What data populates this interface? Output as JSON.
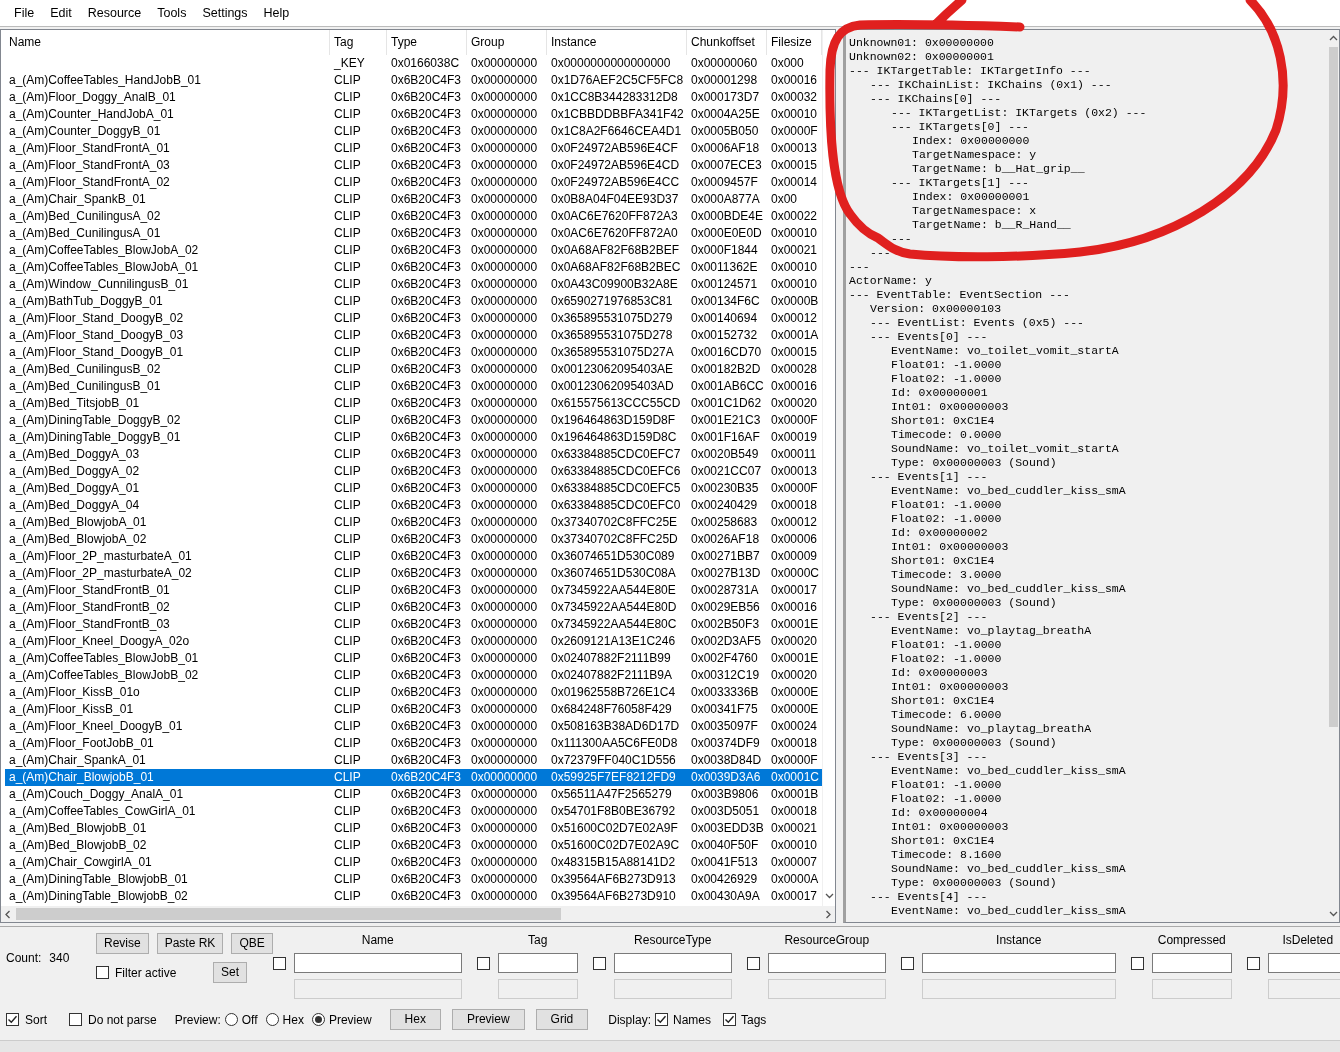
{
  "menu": [
    "File",
    "Edit",
    "Resource",
    "Tools",
    "Settings",
    "Help"
  ],
  "table": {
    "columns": [
      "Name",
      "Tag",
      "Type",
      "Group",
      "Instance",
      "Chunkoffset",
      "Filesize"
    ],
    "rows": [
      {
        "tag": "_KEY",
        "type": "0x0166038C",
        "group": "0x00000000",
        "instance": "0x0000000000000000",
        "chunkoffset": "0x00000060",
        "filesize": "0x000",
        "selected": false
      },
      {
        "name": "a_(Am)CoffeeTables_HandJobB_01",
        "tag": "CLIP",
        "type": "0x6B20C4F3",
        "group": "0x00000000",
        "instance": "0x1D76AEF2C5CF5FC8",
        "chunkoffset": "0x00001298",
        "filesize": "0x00016",
        "selected": false
      },
      {
        "name": "a_(Am)Floor_Doggy_AnalB_01",
        "tag": "CLIP",
        "type": "0x6B20C4F3",
        "group": "0x00000000",
        "instance": "0x1CC8B344283312D8",
        "chunkoffset": "0x000173D7",
        "filesize": "0x00032",
        "selected": false
      },
      {
        "name": "a_(Am)Counter_HandJobA_01",
        "tag": "CLIP",
        "type": "0x6B20C4F3",
        "group": "0x00000000",
        "instance": "0x1CBBDDBBFA341F42",
        "chunkoffset": "0x0004A25E",
        "filesize": "0x00010",
        "selected": false
      },
      {
        "name": "a_(Am)Counter_DoggyB_01",
        "tag": "CLIP",
        "type": "0x6B20C4F3",
        "group": "0x00000000",
        "instance": "0x1C8A2F6646CEA4D1",
        "chunkoffset": "0x0005B050",
        "filesize": "0x0000F",
        "selected": false
      },
      {
        "name": "a_(Am)Floor_StandFrontA_01",
        "tag": "CLIP",
        "type": "0x6B20C4F3",
        "group": "0x00000000",
        "instance": "0x0F24972AB596E4CF",
        "chunkoffset": "0x0006AF18",
        "filesize": "0x00013",
        "selected": false
      },
      {
        "name": "a_(Am)Floor_StandFrontA_03",
        "tag": "CLIP",
        "type": "0x6B20C4F3",
        "group": "0x00000000",
        "instance": "0x0F24972AB596E4CD",
        "chunkoffset": "0x0007ECE3",
        "filesize": "0x00015",
        "selected": false
      },
      {
        "name": "a_(Am)Floor_StandFrontA_02",
        "tag": "CLIP",
        "type": "0x6B20C4F3",
        "group": "0x00000000",
        "instance": "0x0F24972AB596E4CC",
        "chunkoffset": "0x0009457F",
        "filesize": "0x00014",
        "selected": false
      },
      {
        "name": "a_(Am)Chair_SpankB_01",
        "tag": "CLIP",
        "type": "0x6B20C4F3",
        "group": "0x00000000",
        "instance": "0x0B8A04F04EE93D37",
        "chunkoffset": "0x000A877A",
        "filesize": "0x00",
        "selected": false
      },
      {
        "name": "a_(Am)Bed_CunilingusA_02",
        "tag": "CLIP",
        "type": "0x6B20C4F3",
        "group": "0x00000000",
        "instance": "0x0AC6E7620FF872A3",
        "chunkoffset": "0x000BDE4E",
        "filesize": "0x00022",
        "selected": false
      },
      {
        "name": "a_(Am)Bed_CunilingusA_01",
        "tag": "CLIP",
        "type": "0x6B20C4F3",
        "group": "0x00000000",
        "instance": "0x0AC6E7620FF872A0",
        "chunkoffset": "0x000E0E0D",
        "filesize": "0x00010",
        "selected": false
      },
      {
        "name": "a_(Am)CoffeeTables_BlowJobA_02",
        "tag": "CLIP",
        "type": "0x6B20C4F3",
        "group": "0x00000000",
        "instance": "0x0A68AF82F68B2BEF",
        "chunkoffset": "0x000F1844",
        "filesize": "0x00021",
        "selected": false
      },
      {
        "name": "a_(Am)CoffeeTables_BlowJobA_01",
        "tag": "CLIP",
        "type": "0x6B20C4F3",
        "group": "0x00000000",
        "instance": "0x0A68AF82F68B2BEC",
        "chunkoffset": "0x0011362E",
        "filesize": "0x00010",
        "selected": false
      },
      {
        "name": "a_(Am)Window_CunnilingusB_01",
        "tag": "CLIP",
        "type": "0x6B20C4F3",
        "group": "0x00000000",
        "instance": "0x0A43C09900B32A8E",
        "chunkoffset": "0x00124571",
        "filesize": "0x00010",
        "selected": false
      },
      {
        "name": "a_(Am)BathTub_DoggyB_01",
        "tag": "CLIP",
        "type": "0x6B20C4F3",
        "group": "0x00000000",
        "instance": "0x6590271976853C81",
        "chunkoffset": "0x00134F6C",
        "filesize": "0x0000B",
        "selected": false
      },
      {
        "name": "a_(Am)Floor_Stand_DoogyB_02",
        "tag": "CLIP",
        "type": "0x6B20C4F3",
        "group": "0x00000000",
        "instance": "0x365895531075D279",
        "chunkoffset": "0x00140694",
        "filesize": "0x00012",
        "selected": false
      },
      {
        "name": "a_(Am)Floor_Stand_DoogyB_03",
        "tag": "CLIP",
        "type": "0x6B20C4F3",
        "group": "0x00000000",
        "instance": "0x365895531075D278",
        "chunkoffset": "0x00152732",
        "filesize": "0x0001A",
        "selected": false
      },
      {
        "name": "a_(Am)Floor_Stand_DoogyB_01",
        "tag": "CLIP",
        "type": "0x6B20C4F3",
        "group": "0x00000000",
        "instance": "0x365895531075D27A",
        "chunkoffset": "0x0016CD70",
        "filesize": "0x00015",
        "selected": false
      },
      {
        "name": "a_(Am)Bed_CunilingusB_02",
        "tag": "CLIP",
        "type": "0x6B20C4F3",
        "group": "0x00000000",
        "instance": "0x00123062095403AE",
        "chunkoffset": "0x00182B2D",
        "filesize": "0x00028",
        "selected": false
      },
      {
        "name": "a_(Am)Bed_CunilingusB_01",
        "tag": "CLIP",
        "type": "0x6B20C4F3",
        "group": "0x00000000",
        "instance": "0x00123062095403AD",
        "chunkoffset": "0x001AB6CC",
        "filesize": "0x00016",
        "selected": false
      },
      {
        "name": "a_(Am)Bed_TitsjobB_01",
        "tag": "CLIP",
        "type": "0x6B20C4F3",
        "group": "0x00000000",
        "instance": "0x615575613CCC55CD",
        "chunkoffset": "0x001C1D62",
        "filesize": "0x00020",
        "selected": false
      },
      {
        "name": "a_(Am)DiningTable_DoggyB_02",
        "tag": "CLIP",
        "type": "0x6B20C4F3",
        "group": "0x00000000",
        "instance": "0x196464863D159D8F",
        "chunkoffset": "0x001E21C3",
        "filesize": "0x0000F",
        "selected": false
      },
      {
        "name": "a_(Am)DiningTable_DoggyB_01",
        "tag": "CLIP",
        "type": "0x6B20C4F3",
        "group": "0x00000000",
        "instance": "0x196464863D159D8C",
        "chunkoffset": "0x001F16AF",
        "filesize": "0x00019",
        "selected": false
      },
      {
        "name": "a_(Am)Bed_DoggyA_03",
        "tag": "CLIP",
        "type": "0x6B20C4F3",
        "group": "0x00000000",
        "instance": "0x63384885CDC0EFC7",
        "chunkoffset": "0x0020B549",
        "filesize": "0x00011",
        "selected": false
      },
      {
        "name": "a_(Am)Bed_DoggyA_02",
        "tag": "CLIP",
        "type": "0x6B20C4F3",
        "group": "0x00000000",
        "instance": "0x63384885CDC0EFC6",
        "chunkoffset": "0x0021CC07",
        "filesize": "0x00013",
        "selected": false
      },
      {
        "name": "a_(Am)Bed_DoggyA_01",
        "tag": "CLIP",
        "type": "0x6B20C4F3",
        "group": "0x00000000",
        "instance": "0x63384885CDC0EFC5",
        "chunkoffset": "0x00230B35",
        "filesize": "0x0000F",
        "selected": false
      },
      {
        "name": "a_(Am)Bed_DoggyA_04",
        "tag": "CLIP",
        "type": "0x6B20C4F3",
        "group": "0x00000000",
        "instance": "0x63384885CDC0EFC0",
        "chunkoffset": "0x00240429",
        "filesize": "0x00018",
        "selected": false
      },
      {
        "name": "a_(Am)Bed_BlowjobA_01",
        "tag": "CLIP",
        "type": "0x6B20C4F3",
        "group": "0x00000000",
        "instance": "0x37340702C8FFC25E",
        "chunkoffset": "0x00258683",
        "filesize": "0x00012",
        "selected": false
      },
      {
        "name": "a_(Am)Bed_BlowjobA_02",
        "tag": "CLIP",
        "type": "0x6B20C4F3",
        "group": "0x00000000",
        "instance": "0x37340702C8FFC25D",
        "chunkoffset": "0x0026AF18",
        "filesize": "0x00006",
        "selected": false
      },
      {
        "name": "a_(Am)Floor_2P_masturbateA_01",
        "tag": "CLIP",
        "type": "0x6B20C4F3",
        "group": "0x00000000",
        "instance": "0x36074651D530C089",
        "chunkoffset": "0x00271BB7",
        "filesize": "0x00009",
        "selected": false
      },
      {
        "name": "a_(Am)Floor_2P_masturbateA_02",
        "tag": "CLIP",
        "type": "0x6B20C4F3",
        "group": "0x00000000",
        "instance": "0x36074651D530C08A",
        "chunkoffset": "0x0027B13D",
        "filesize": "0x0000C",
        "selected": false
      },
      {
        "name": "a_(Am)Floor_StandFrontB_01",
        "tag": "CLIP",
        "type": "0x6B20C4F3",
        "group": "0x00000000",
        "instance": "0x7345922AA544E80E",
        "chunkoffset": "0x0028731A",
        "filesize": "0x00017",
        "selected": false
      },
      {
        "name": "a_(Am)Floor_StandFrontB_02",
        "tag": "CLIP",
        "type": "0x6B20C4F3",
        "group": "0x00000000",
        "instance": "0x7345922AA544E80D",
        "chunkoffset": "0x0029EB56",
        "filesize": "0x00016",
        "selected": false
      },
      {
        "name": "a_(Am)Floor_StandFrontB_03",
        "tag": "CLIP",
        "type": "0x6B20C4F3",
        "group": "0x00000000",
        "instance": "0x7345922AA544E80C",
        "chunkoffset": "0x002B50F3",
        "filesize": "0x0001E",
        "selected": false
      },
      {
        "name": "a_(Am)Floor_Kneel_DoogyA_02o",
        "tag": "CLIP",
        "type": "0x6B20C4F3",
        "group": "0x00000000",
        "instance": "0x2609121A13E1C246",
        "chunkoffset": "0x002D3AF5",
        "filesize": "0x00020",
        "selected": false
      },
      {
        "name": "a_(Am)CoffeeTables_BlowJobB_01",
        "tag": "CLIP",
        "type": "0x6B20C4F3",
        "group": "0x00000000",
        "instance": "0x02407882F2111B99",
        "chunkoffset": "0x002F4760",
        "filesize": "0x0001E",
        "selected": false
      },
      {
        "name": "a_(Am)CoffeeTables_BlowJobB_02",
        "tag": "CLIP",
        "type": "0x6B20C4F3",
        "group": "0x00000000",
        "instance": "0x02407882F2111B9A",
        "chunkoffset": "0x00312C19",
        "filesize": "0x00020",
        "selected": false
      },
      {
        "name": "a_(Am)Floor_KissB_01o",
        "tag": "CLIP",
        "type": "0x6B20C4F3",
        "group": "0x00000000",
        "instance": "0x01962558B726E1C4",
        "chunkoffset": "0x0033336B",
        "filesize": "0x0000E",
        "selected": false
      },
      {
        "name": "a_(Am)Floor_KissB_01",
        "tag": "CLIP",
        "type": "0x6B20C4F3",
        "group": "0x00000000",
        "instance": "0x684248F76058F429",
        "chunkoffset": "0x00341F75",
        "filesize": "0x0000E",
        "selected": false
      },
      {
        "name": "a_(Am)Floor_Kneel_DoogyB_01",
        "tag": "CLIP",
        "type": "0x6B20C4F3",
        "group": "0x00000000",
        "instance": "0x508163B38AD6D17D",
        "chunkoffset": "0x0035097F",
        "filesize": "0x00024",
        "selected": false
      },
      {
        "name": "a_(Am)Floor_FootJobB_01",
        "tag": "CLIP",
        "type": "0x6B20C4F3",
        "group": "0x00000000",
        "instance": "0x111300AA5C6FE0D8",
        "chunkoffset": "0x00374DF9",
        "filesize": "0x00018",
        "selected": false
      },
      {
        "name": "a_(Am)Chair_SpankA_01",
        "tag": "CLIP",
        "type": "0x6B20C4F3",
        "group": "0x00000000",
        "instance": "0x72379FF040C1D556",
        "chunkoffset": "0x0038D84D",
        "filesize": "0x0000F",
        "selected": false
      },
      {
        "name": "a_(Am)Chair_BlowjobB_01",
        "tag": "CLIP",
        "type": "0x6B20C4F3",
        "group": "0x00000000",
        "instance": "0x59925F7EF8212FD9",
        "chunkoffset": "0x0039D3A6",
        "filesize": "0x0001C",
        "selected": true
      },
      {
        "name": "a_(Am)Couch_Doggy_AnalA_01",
        "tag": "CLIP",
        "type": "0x6B20C4F3",
        "group": "0x00000000",
        "instance": "0x56511A47F2565279",
        "chunkoffset": "0x003B9806",
        "filesize": "0x0001B",
        "selected": false
      },
      {
        "name": "a_(Am)CoffeeTables_CowGirlA_01",
        "tag": "CLIP",
        "type": "0x6B20C4F3",
        "group": "0x00000000",
        "instance": "0x54701F8B0BE36792",
        "chunkoffset": "0x003D5051",
        "filesize": "0x00018",
        "selected": false
      },
      {
        "name": "a_(Am)Bed_BlowjobB_01",
        "tag": "CLIP",
        "type": "0x6B20C4F3",
        "group": "0x00000000",
        "instance": "0x51600C02D7E02A9F",
        "chunkoffset": "0x003EDD3B",
        "filesize": "0x00021",
        "selected": false
      },
      {
        "name": "a_(Am)Bed_BlowjobB_02",
        "tag": "CLIP",
        "type": "0x6B20C4F3",
        "group": "0x00000000",
        "instance": "0x51600C02D7E02A9C",
        "chunkoffset": "0x0040F50F",
        "filesize": "0x00010",
        "selected": false
      },
      {
        "name": "a_(Am)Chair_CowgirlA_01",
        "tag": "CLIP",
        "type": "0x6B20C4F3",
        "group": "0x00000000",
        "instance": "0x48315B15A88141D2",
        "chunkoffset": "0x0041F513",
        "filesize": "0x00007",
        "selected": false
      },
      {
        "name": "a_(Am)DiningTable_BlowjobB_01",
        "tag": "CLIP",
        "type": "0x6B20C4F3",
        "group": "0x00000000",
        "instance": "0x39564AF6B273D913",
        "chunkoffset": "0x00426929",
        "filesize": "0x0000A",
        "selected": false
      },
      {
        "name": "a_(Am)DiningTable_BlowjobB_02",
        "tag": "CLIP",
        "type": "0x6B20C4F3",
        "group": "0x00000000",
        "instance": "0x39564AF6B273D910",
        "chunkoffset": "0x00430A9A",
        "filesize": "0x00017",
        "selected": false
      }
    ]
  },
  "preview_text": [
    {
      "text": "Unknown01: 0x00000000"
    },
    {
      "text": "Unknown02: 0x00000001"
    },
    {
      "text": "--- IKTargetTable: IKTargetInfo ---",
      "children": [
        {
          "text": "--- IKChainList: IKChains (0x1) ---"
        },
        {
          "text": "--- IKChains[0] ---",
          "children": [
            {
              "text": "--- IKTargetList: IKTargets (0x2) ---"
            },
            {
              "text": "--- IKTargets[0] ---",
              "children": [
                {
                  "text": "Index: 0x00000000"
                },
                {
                  "text": "TargetNamespace: y"
                },
                {
                  "text": "TargetName: b__Hat_grip__"
                }
              ]
            },
            {
              "text": "--- IKTargets[1] ---",
              "children": [
                {
                  "text": "Index: 0x00000001"
                },
                {
                  "text": "TargetNamespace: x"
                },
                {
                  "text": "TargetName: b__R_Hand__"
                }
              ]
            },
            {
              "text": "---"
            }
          ]
        },
        {
          "text": "---"
        }
      ]
    },
    {
      "text": "---"
    },
    {
      "text": "ActorName: y"
    },
    {
      "text": "--- EventTable: EventSection ---",
      "children": [
        {
          "text": "Version: 0x00000103"
        },
        {
          "text": "--- EventList: Events (0x5) ---"
        },
        {
          "text": "--- Events[0] ---",
          "children": [
            {
              "text": "EventName: vo_toilet_vomit_startA"
            },
            {
              "text": "Float01: -1.0000"
            },
            {
              "text": "Float02: -1.0000"
            },
            {
              "text": "Id: 0x00000001"
            },
            {
              "text": "Int01: 0x00000003"
            },
            {
              "text": "Short01: 0xC1E4"
            },
            {
              "text": "Timecode: 0.0000"
            },
            {
              "text": "SoundName: vo_toilet_vomit_startA"
            },
            {
              "text": "Type: 0x00000003 (Sound)"
            }
          ]
        },
        {
          "text": "--- Events[1] ---",
          "children": [
            {
              "text": "EventName: vo_bed_cuddler_kiss_smA"
            },
            {
              "text": "Float01: -1.0000"
            },
            {
              "text": "Float02: -1.0000"
            },
            {
              "text": "Id: 0x00000002"
            },
            {
              "text": "Int01: 0x00000003"
            },
            {
              "text": "Short01: 0xC1E4"
            },
            {
              "text": "Timecode: 3.0000"
            },
            {
              "text": "SoundName: vo_bed_cuddler_kiss_smA"
            },
            {
              "text": "Type: 0x00000003 (Sound)"
            }
          ]
        },
        {
          "text": "--- Events[2] ---",
          "children": [
            {
              "text": "EventName: vo_playtag_breathA"
            },
            {
              "text": "Float01: -1.0000"
            },
            {
              "text": "Float02: -1.0000"
            },
            {
              "text": "Id: 0x00000003"
            },
            {
              "text": "Int01: 0x00000003"
            },
            {
              "text": "Short01: 0xC1E4"
            },
            {
              "text": "Timecode: 6.0000"
            },
            {
              "text": "SoundName: vo_playtag_breathA"
            },
            {
              "text": "Type: 0x00000003 (Sound)"
            }
          ]
        },
        {
          "text": "--- Events[3] ---",
          "children": [
            {
              "text": "EventName: vo_bed_cuddler_kiss_smA"
            },
            {
              "text": "Float01: -1.0000"
            },
            {
              "text": "Float02: -1.0000"
            },
            {
              "text": "Id: 0x00000004"
            },
            {
              "text": "Int01: 0x00000003"
            },
            {
              "text": "Short01: 0xC1E4"
            },
            {
              "text": "Timecode: 8.1600"
            },
            {
              "text": "SoundName: vo_bed_cuddler_kiss_smA"
            },
            {
              "text": "Type: 0x00000003 (Sound)"
            }
          ]
        },
        {
          "text": "--- Events[4] ---",
          "children": [
            {
              "text": "EventName: vo_bed_cuddler_kiss_smA"
            }
          ]
        }
      ]
    }
  ],
  "bottom": {
    "count_label": "Count:",
    "count": "340",
    "buttons": [
      "Revise",
      "Paste RK",
      "QBE"
    ],
    "filter_active": {
      "label": "Filter active",
      "checked": false
    },
    "set_button": "Set",
    "filters": [
      {
        "label": "Name",
        "checked": false
      },
      {
        "label": "Tag",
        "checked": false
      },
      {
        "label": "ResourceType",
        "checked": false
      },
      {
        "label": "ResourceGroup",
        "checked": false
      },
      {
        "label": "Instance",
        "checked": false
      },
      {
        "label": "Compressed",
        "checked": false
      },
      {
        "label": "IsDeleted",
        "checked": false
      }
    ],
    "options": [
      {
        "label": "Sort",
        "checked": true
      },
      {
        "label": "Do not parse",
        "checked": false
      }
    ],
    "preview": {
      "label": "Preview:",
      "options": [
        {
          "label": "Off",
          "selected": false
        },
        {
          "label": "Hex",
          "selected": false
        },
        {
          "label": "Preview",
          "selected": true
        }
      ]
    },
    "view_buttons": [
      "Hex",
      "Preview",
      "Grid"
    ],
    "display": {
      "label": "Display:",
      "options": [
        {
          "label": "Names",
          "checked": true
        },
        {
          "label": "Tags",
          "checked": true
        }
      ]
    }
  }
}
